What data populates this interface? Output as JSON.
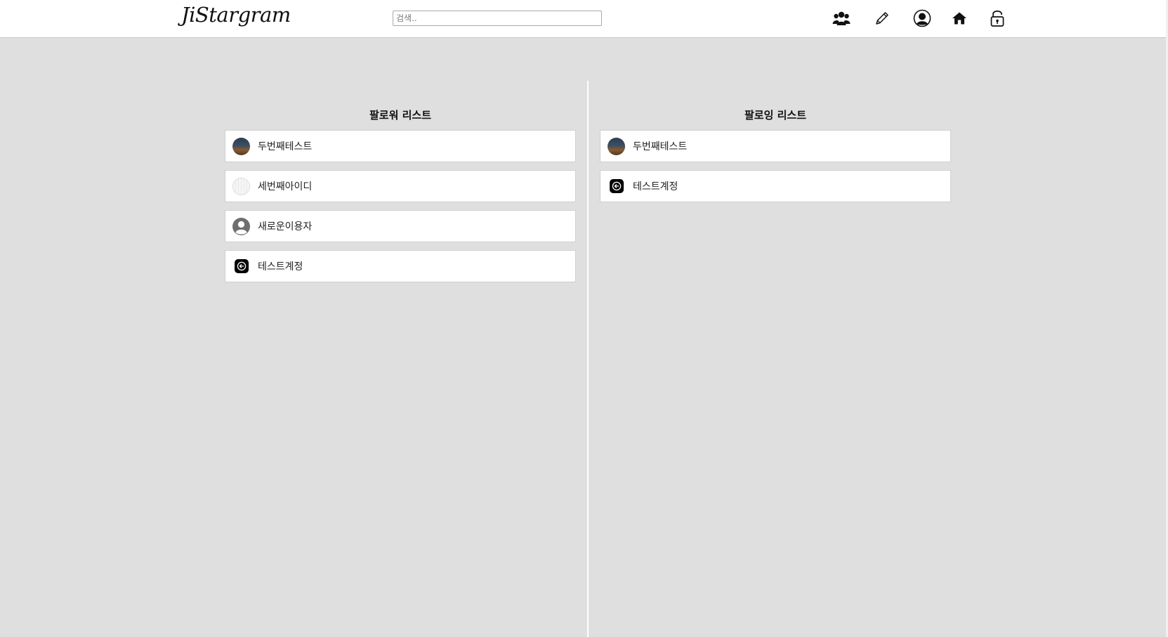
{
  "header": {
    "logo": "JiStargram",
    "search_placeholder": "검색..",
    "icons": [
      "users-icon",
      "pencil-icon",
      "profile-icon",
      "home-icon",
      "unlock-icon"
    ]
  },
  "followers": {
    "title": "팔로워 리스트",
    "users": [
      {
        "name": "두번째테스트",
        "avatar": "photo-avatar"
      },
      {
        "name": "세번째아이디",
        "avatar": "pale-photo-avatar"
      },
      {
        "name": "새로운이용자",
        "avatar": "default-user-avatar"
      },
      {
        "name": "테스트계정",
        "avatar": "back-arrow-avatar"
      }
    ]
  },
  "following": {
    "title": "팔로잉 리스트",
    "users": [
      {
        "name": "두번째테스트",
        "avatar": "photo-avatar"
      },
      {
        "name": "테스트계정",
        "avatar": "back-arrow-avatar"
      }
    ]
  }
}
